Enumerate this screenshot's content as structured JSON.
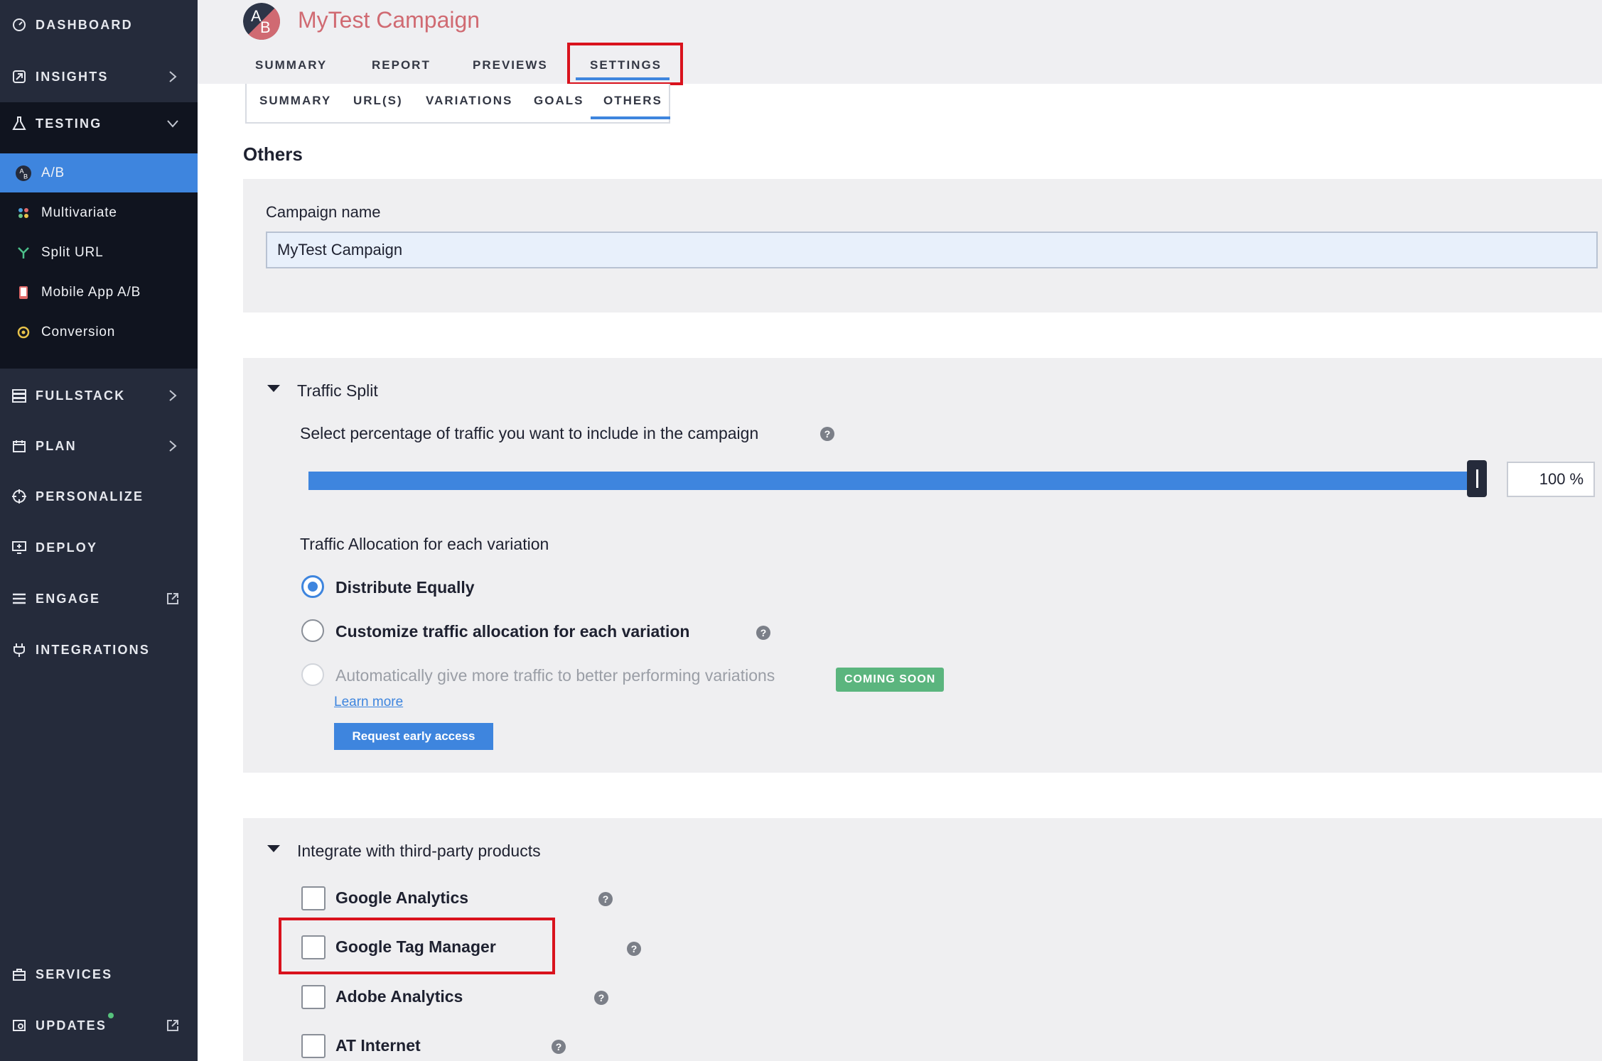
{
  "sidebar": {
    "dashboard": "DASHBOARD",
    "insights": "INSIGHTS",
    "testing": "TESTING",
    "testing_items": [
      {
        "label": "A/B"
      },
      {
        "label": "Multivariate"
      },
      {
        "label": "Split URL"
      },
      {
        "label": "Mobile App A/B"
      },
      {
        "label": "Conversion"
      }
    ],
    "fullstack": "FULLSTACK",
    "plan": "PLAN",
    "personalize": "PERSONALIZE",
    "deploy": "DEPLOY",
    "engage": "ENGAGE",
    "integrations": "INTEGRATIONS",
    "services": "SERVICES",
    "updates": "UPDATES"
  },
  "header": {
    "logo_text_a": "A",
    "logo_text_b": "B",
    "title": "MyTest Campaign",
    "tabs": [
      "SUMMARY",
      "REPORT",
      "PREVIEWS",
      "SETTINGS"
    ],
    "active_tab": "SETTINGS"
  },
  "subtabs": {
    "items": [
      "SUMMARY",
      "URL(S)",
      "VARIATIONS",
      "GOALS",
      "OTHERS"
    ],
    "active": "OTHERS"
  },
  "section_title": "Others",
  "campaign_name": {
    "label": "Campaign name",
    "value": "MyTest Campaign"
  },
  "traffic_split": {
    "heading": "Traffic Split",
    "slider_label": "Select percentage of traffic you want to include in the campaign",
    "value": "100",
    "unit": "%",
    "fraction": 1.0,
    "allocation_heading": "Traffic Allocation for each variation",
    "options": [
      {
        "label": "Distribute Equally",
        "checked": true
      },
      {
        "label": "Customize traffic allocation for each variation",
        "checked": false
      },
      {
        "label": "Automatically give more traffic to better performing variations",
        "checked": false,
        "disabled": true
      }
    ],
    "badge": "COMING SOON",
    "learn_more": "Learn more",
    "request_button": "Request early access"
  },
  "integrations": {
    "heading": "Integrate with third-party products",
    "items": [
      {
        "label": "Google Analytics",
        "checked": false
      },
      {
        "label": "Google Tag Manager",
        "checked": false
      },
      {
        "label": "Adobe Analytics",
        "checked": false
      },
      {
        "label": "AT Internet",
        "checked": false
      }
    ]
  },
  "help_glyph": "?",
  "colors": {
    "accent": "#3e85de",
    "sidebar_bg": "#252b3b",
    "title": "#d06a72",
    "highlight_box": "#d9121d",
    "badge": "#5bb57e"
  }
}
